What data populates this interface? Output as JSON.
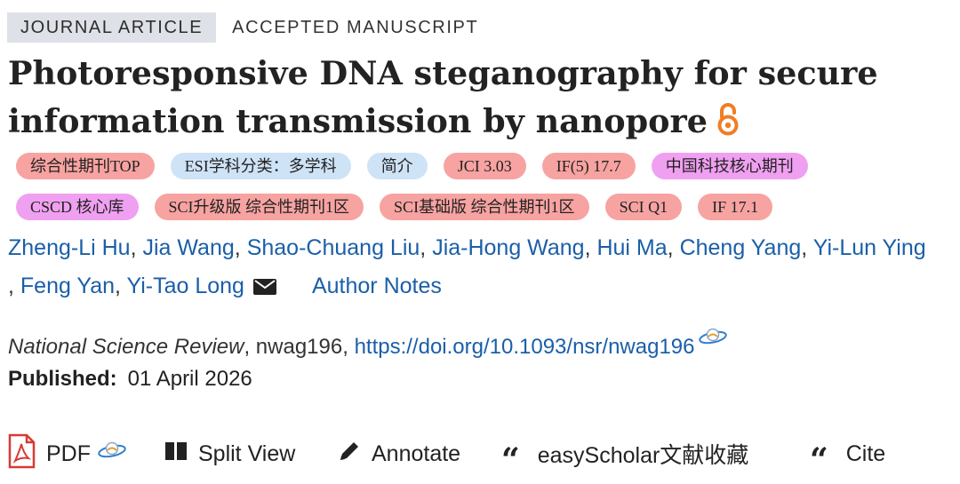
{
  "article_type": "JOURNAL ARTICLE",
  "status": "ACCEPTED MANUSCRIPT",
  "title": "Photoresponsive DNA steganography for secure information transmission by nanopore",
  "open_access_icon": "open-access-lock-icon",
  "tags_row1": [
    {
      "label": "综合性期刊TOP",
      "color": "#f7a3a1"
    },
    {
      "label": "ESI学科分类：多学科",
      "color": "#cfe3f7"
    },
    {
      "label": "简介",
      "color": "#cfe3f7"
    },
    {
      "label": "JCI 3.03",
      "color": "#f7a3a1"
    },
    {
      "label": "IF(5) 17.7",
      "color": "#f7a3a1"
    },
    {
      "label": "中国科技核心期刊",
      "color": "#f0a0f0"
    }
  ],
  "tags_row2": [
    {
      "label": "CSCD 核心库",
      "color": "#f0a0f0"
    },
    {
      "label": "SCI升级版 综合性期刊1区",
      "color": "#f7a3a1"
    },
    {
      "label": "SCI基础版 综合性期刊1区",
      "color": "#f7a3a1"
    },
    {
      "label": "SCI Q1",
      "color": "#f7a3a1"
    },
    {
      "label": "IF 17.1",
      "color": "#f7a3a1"
    }
  ],
  "authors": [
    "Zheng-Li Hu",
    "Jia Wang",
    "Shao-Chuang Liu",
    "Jia-Hong Wang",
    "Hui Ma",
    "Cheng Yang",
    "Yi-Lun Ying",
    "Feng Yan",
    "Yi-Tao Long"
  ],
  "corresponding_icon": "envelope-icon",
  "author_notes": "Author Notes",
  "citation": {
    "journal": "National Science Review",
    "separator": ", nwag196, ",
    "doi": "https://doi.org/10.1093/nsr/nwag196"
  },
  "published": {
    "label": "Published:",
    "date": "01 April 2026"
  },
  "toolbar": {
    "pdf": "PDF",
    "split_view": "Split View",
    "annotate": "Annotate",
    "easyscholar": "easyScholar文献收藏",
    "cite": "Cite"
  },
  "accent_link_color": "#1a5fa8"
}
